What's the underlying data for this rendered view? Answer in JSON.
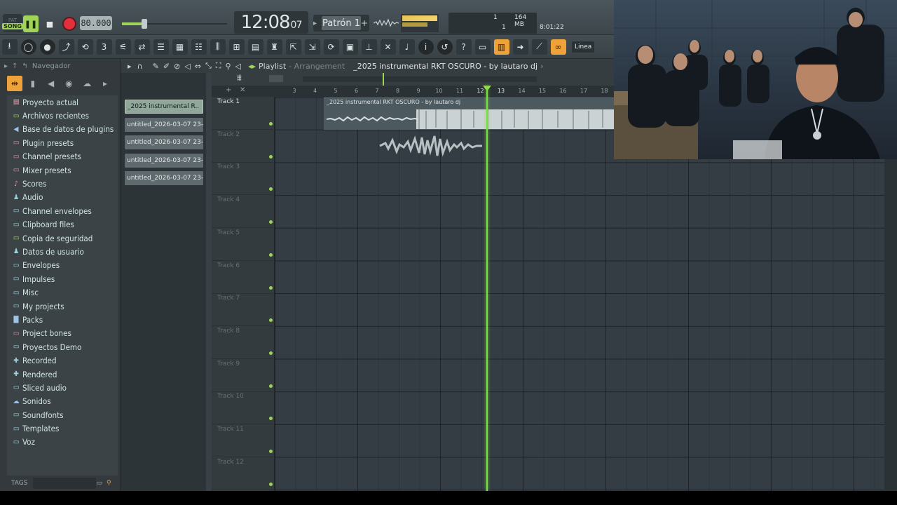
{
  "transport": {
    "pat_label": "PAT",
    "song_label": "SONG",
    "play_symbol": "❚❚",
    "stop_symbol": "■",
    "tempo": "80.000",
    "clock_main": "12:08",
    "clock_small": "07",
    "pattern": "Patrón 1",
    "pattern_arrow": "▸",
    "pattern_plus": "+",
    "hint_a": "1",
    "hint_b": "164 MB",
    "hint_c": "1",
    "time_readout": "8:01:22",
    "accent_color": "#9fd35a",
    "record_color": "#e2303d"
  },
  "toolbar": {
    "icons": [
      "export-icon",
      "metronome-icon",
      "record-mode-icon",
      "wait-icon",
      "step-icon",
      "blend-icon",
      "snap-icon",
      "pattern-icon",
      "playlist-icon",
      "piano-roll-icon",
      "channel-rack-icon",
      "mixer-icon",
      "plugin-picker-icon",
      "browser-icon",
      "project-icon",
      "tempo-icon",
      "cut-icon",
      "mic-icon",
      "info-icon",
      "undo-icon",
      "help-icon",
      "touch-icon",
      "keyboard-icon",
      "arrow-icon",
      "brush-icon",
      "link-icon"
    ],
    "linea_label": "Línea"
  },
  "browser": {
    "title": "Navegador",
    "items": [
      {
        "label": "Proyecto actual",
        "icon": "▤",
        "color": "#e8a0b0"
      },
      {
        "label": "Archivos recientes",
        "icon": "▭",
        "color": "#9fd35a"
      },
      {
        "label": "Base de datos de plugins",
        "icon": "◀",
        "color": "#9fc3e8"
      },
      {
        "label": "Plugin presets",
        "icon": "▭",
        "color": "#e08fb3"
      },
      {
        "label": "Channel presets",
        "icon": "▭",
        "color": "#e08fb3"
      },
      {
        "label": "Mixer presets",
        "icon": "▭",
        "color": "#e08fb3"
      },
      {
        "label": "Scores",
        "icon": "♪",
        "color": "#e08fb3"
      },
      {
        "label": "Audio",
        "icon": "♟",
        "color": "#8fcfe0"
      },
      {
        "label": "Channel envelopes",
        "icon": "▭",
        "color": "#9fd3e0"
      },
      {
        "label": "Clipboard files",
        "icon": "▭",
        "color": "#9fd3e0"
      },
      {
        "label": "Copia de seguridad",
        "icon": "▭",
        "color": "#9fd35a"
      },
      {
        "label": "Datos de usuario",
        "icon": "♟",
        "color": "#9fd3e0"
      },
      {
        "label": "Envelopes",
        "icon": "▭",
        "color": "#9fd3e0"
      },
      {
        "label": "Impulses",
        "icon": "▭",
        "color": "#9fd3e0"
      },
      {
        "label": "Misc",
        "icon": "▭",
        "color": "#9fd3e0"
      },
      {
        "label": "My projects",
        "icon": "▭",
        "color": "#9fd3e0"
      },
      {
        "label": "Packs",
        "icon": "▇",
        "color": "#9fc3e8"
      },
      {
        "label": "Project bones",
        "icon": "▭",
        "color": "#e08fb3"
      },
      {
        "label": "Proyectos Demo",
        "icon": "▭",
        "color": "#9fd3e0"
      },
      {
        "label": "Recorded",
        "icon": "✚",
        "color": "#9fd3e0"
      },
      {
        "label": "Rendered",
        "icon": "✚",
        "color": "#9fd3e0"
      },
      {
        "label": "Sliced audio",
        "icon": "▭",
        "color": "#9fd3e0"
      },
      {
        "label": "Sonidos",
        "icon": "☁",
        "color": "#9fc3e8"
      },
      {
        "label": "Soundfonts",
        "icon": "▭",
        "color": "#9fd3e0"
      },
      {
        "label": "Templates",
        "icon": "▭",
        "color": "#9fd3e0"
      },
      {
        "label": "Voz",
        "icon": "▭",
        "color": "#9fd3e0"
      }
    ],
    "tags_label": "TAGS"
  },
  "clips": [
    "_2025 instrumental R..",
    "untitled_2026-03-07 23-..",
    "untitled_2026-03-07 23-..",
    "untitled_2026-03-07 23-..",
    "untitled_2026-03-07 23-.."
  ],
  "playlist": {
    "title": "Playlist",
    "crumb": "Arrangement",
    "project_name": "_2025 instrumental RKT OSCURO - by lautaro dj",
    "clip_title": "_2025 instrumental RKT OSCURO - by lautaro dj",
    "ruler": [
      "3",
      "4",
      "5",
      "6",
      "7",
      "8",
      "9",
      "10",
      "11",
      "12",
      "13",
      "14",
      "15",
      "16",
      "17",
      "18"
    ],
    "tracks": [
      "Track 1",
      "Track 2",
      "Track 3",
      "Track 4",
      "Track 5",
      "Track 6",
      "Track 7",
      "Track 8",
      "Track 9",
      "Track 10",
      "Track 11",
      "Track 12"
    ],
    "playhead_bar": 12.4
  }
}
